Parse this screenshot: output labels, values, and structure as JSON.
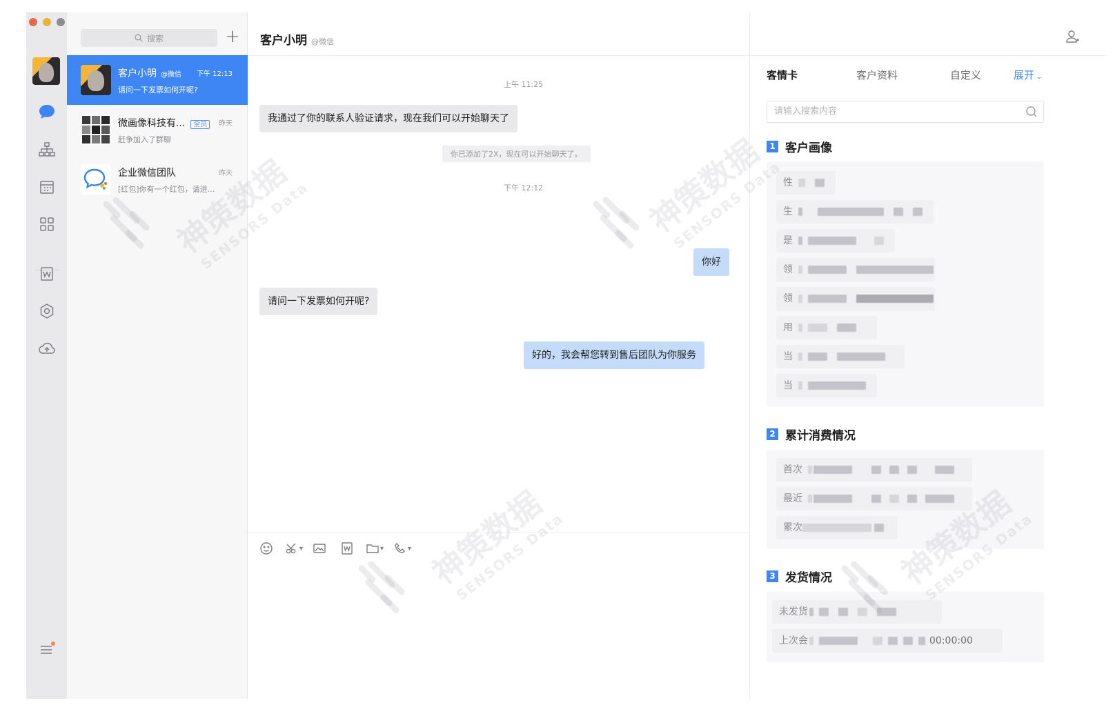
{
  "window": {
    "traffic": [
      "#e36c4a",
      "#e7b33b",
      "#8c8c92"
    ]
  },
  "rail": {
    "icons": [
      "user-avatar",
      "chat-bubble-icon",
      "org-chart-icon",
      "calendar-icon",
      "apps-grid-icon",
      "word-doc-icon",
      "hexagon-settings-icon",
      "cloud-drive-icon",
      "menu-more-icon"
    ],
    "active_color": "#3f86f5",
    "notification_dot_color": "#f08a3c"
  },
  "convlist": {
    "search_placeholder": "搜索",
    "add_label": "+",
    "items": [
      {
        "name": "客户小明",
        "tag": "@微信",
        "time": "下午 12:13",
        "preview": "请问一下发票如何开呢?",
        "active": true
      },
      {
        "name": "微画像科技有...",
        "tag": "全员",
        "time": "昨天",
        "preview": "赶争加入了群聊",
        "active": false
      },
      {
        "name": "企业微信团队",
        "tag": "",
        "time": "昨天",
        "preview": "[红包]你有一个红包，请进...",
        "active": false
      }
    ]
  },
  "chat": {
    "title": "客户小明",
    "via": "@微信",
    "messages": [
      {
        "type": "time",
        "text": "上午 11:25"
      },
      {
        "type": "in",
        "text": "我通过了你的联系人验证请求，现在我们可以开始聊天了"
      },
      {
        "type": "system",
        "text": "你已添加了2X，现在可以开始聊天了。"
      },
      {
        "type": "time",
        "text": "下午 12:12"
      },
      {
        "type": "out",
        "text": "你好"
      },
      {
        "type": "in",
        "text": "请问一下发票如何开呢?"
      },
      {
        "type": "out",
        "text": "好的，我会帮您转到售后团队为你服务"
      }
    ],
    "toolbar": [
      "emoji-icon",
      "scissors-icon",
      "image-icon",
      "word-doc-icon",
      "folder-icon",
      "phone-icon"
    ]
  },
  "panel": {
    "tabs": [
      "客情卡",
      "客户资料",
      "自定义",
      "展开"
    ],
    "search_placeholder": "请输入搜索内容",
    "sections": [
      {
        "num": "1",
        "title": "客户画像",
        "fields": [
          "性",
          "生",
          "是",
          "领",
          "领",
          "用",
          "当",
          "当"
        ]
      },
      {
        "num": "2",
        "title": "累计消费情况",
        "fields": [
          "首次",
          "最近",
          "累次"
        ]
      },
      {
        "num": "3",
        "title": "发货情况",
        "fields": [
          "未发货",
          "上次会"
        ],
        "last_value": "00:00:00"
      }
    ]
  },
  "watermark": {
    "cn": "神策数据",
    "en": "SENSORS Data"
  }
}
